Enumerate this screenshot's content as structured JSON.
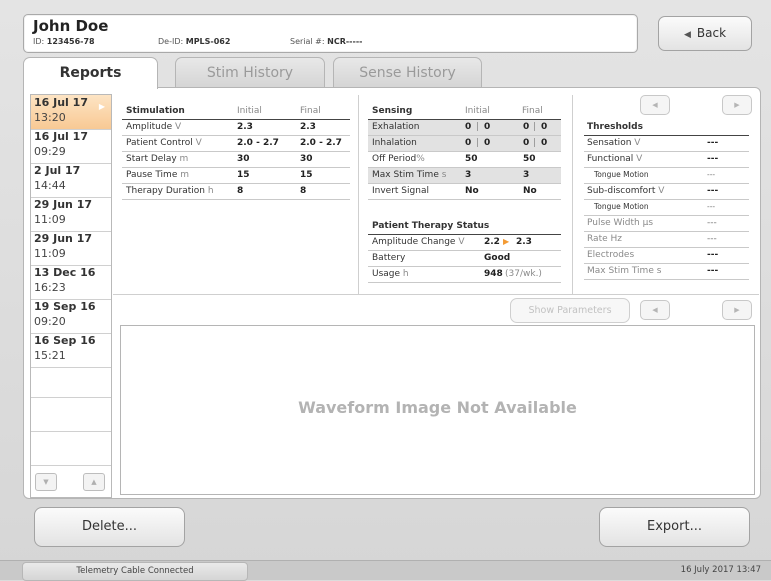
{
  "patient": {
    "name": "John Doe",
    "id_label": "ID:",
    "id": "123456-78",
    "deid_label": "De-ID:",
    "deid": "MPLS-062",
    "serial_label": "Serial #:",
    "serial": "NCR-----"
  },
  "header": {
    "back_label": "Back"
  },
  "tabs": [
    {
      "label": "Reports"
    },
    {
      "label": "Stim History"
    },
    {
      "label": "Sense History"
    }
  ],
  "sessions": [
    {
      "date": "16 Jul 17",
      "time": "13:20"
    },
    {
      "date": "16 Jul 17",
      "time": "09:29"
    },
    {
      "date": "2 Jul 17",
      "time": "14:44"
    },
    {
      "date": "29 Jun 17",
      "time": "11:09"
    },
    {
      "date": "29 Jun 17",
      "time": "11:09"
    },
    {
      "date": "13 Dec 16",
      "time": "16:23"
    },
    {
      "date": "19 Sep 16",
      "time": "09:20"
    },
    {
      "date": "16 Sep 16",
      "time": "15:21"
    }
  ],
  "stimulation": {
    "title": "Stimulation",
    "col_initial": "Initial",
    "col_final": "Final",
    "rows": [
      {
        "label": "Amplitude",
        "unit": "V",
        "initial": "2.3",
        "final": "2.3"
      },
      {
        "label": "Patient Control",
        "unit": "V",
        "initial": "2.0 - 2.7",
        "final": "2.0 - 2.7"
      },
      {
        "label": "Start Delay",
        "unit": "m",
        "initial": "30",
        "final": "30"
      },
      {
        "label": "Pause Time",
        "unit": "m",
        "initial": "15",
        "final": "15"
      },
      {
        "label": "Therapy Duration",
        "unit": "h",
        "initial": "8",
        "final": "8"
      }
    ]
  },
  "sensing": {
    "title": "Sensing",
    "col_initial": "Initial",
    "col_final": "Final",
    "rows": [
      {
        "label": "Exhalation",
        "unit": "",
        "i1": "0",
        "i2": "0",
        "f1": "0",
        "f2": "0"
      },
      {
        "label": "Inhalation",
        "unit": "",
        "i1": "0",
        "i2": "0",
        "f1": "0",
        "f2": "0"
      },
      {
        "label": "Off Period",
        "unit": "%",
        "initial": "50",
        "final": "50"
      },
      {
        "label": "Max Stim Time",
        "unit": "s",
        "initial": "3",
        "final": "3"
      },
      {
        "label": "Invert Signal",
        "unit": "",
        "initial": "No",
        "final": "No"
      }
    ]
  },
  "therapy_status": {
    "title": "Patient Therapy Status",
    "amp_label": "Amplitude Change",
    "amp_unit": "V",
    "amp_from": "2.2",
    "amp_to": "2.3",
    "battery_label": "Battery",
    "battery": "Good",
    "usage_label": "Usage",
    "usage_unit": "h",
    "usage": "948",
    "usage_rate": "(37/wk.)"
  },
  "thresholds": {
    "title": "Thresholds",
    "rows": [
      {
        "label": "Sensation",
        "unit": "V",
        "value": "---"
      },
      {
        "label": "Functional",
        "unit": "V",
        "value": "---"
      },
      {
        "label": "Tongue Motion",
        "unit": "",
        "value": "---"
      },
      {
        "label": "Sub-discomfort",
        "unit": "V",
        "value": "---"
      },
      {
        "label": "Tongue Motion",
        "unit": "",
        "value": "---"
      },
      {
        "label": "Pulse Width",
        "unit": "µs",
        "value": "---"
      },
      {
        "label": "Rate",
        "unit": "Hz",
        "value": "---"
      },
      {
        "label": "Electrodes",
        "unit": "",
        "value": "---"
      },
      {
        "label": "Max Stim Time",
        "unit": "s",
        "value": "---"
      }
    ]
  },
  "waveform": {
    "show_params": "Show Parameters",
    "message": "Waveform Image Not Available"
  },
  "footer": {
    "delete_label": "Delete...",
    "export_label": "Export..."
  },
  "status": {
    "left": "Telemetry Cable Connected",
    "right": "16 July 2017 13:47"
  },
  "icons": {
    "back": "triangle-left-icon",
    "scroll_up": "triangle-up-icon",
    "scroll_down": "triangle-down-icon"
  },
  "colors": {
    "selected": "#f8c994",
    "accent_arrow": "#f39a33"
  }
}
